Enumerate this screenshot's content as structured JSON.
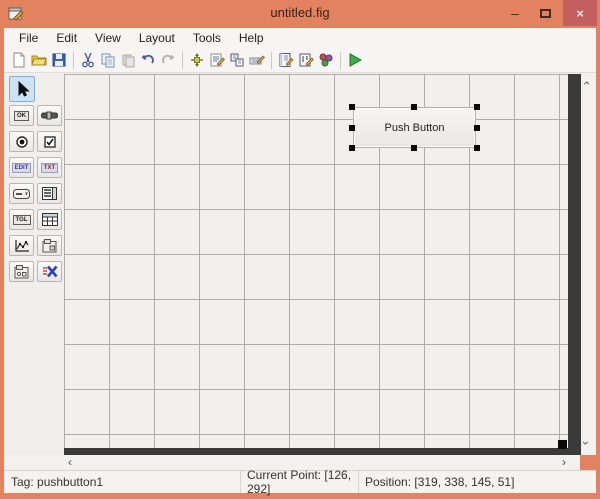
{
  "window": {
    "title": "untitled.fig",
    "controls": {
      "minimize_glyph": "–",
      "close_glyph": "×"
    }
  },
  "menu": {
    "items": [
      {
        "label": "File"
      },
      {
        "label": "Edit"
      },
      {
        "label": "View"
      },
      {
        "label": "Layout"
      },
      {
        "label": "Tools"
      },
      {
        "label": "Help"
      }
    ]
  },
  "toolbar": {
    "icons": [
      {
        "name": "new-figure-icon",
        "enabled": true
      },
      {
        "name": "open-figure-icon",
        "enabled": true
      },
      {
        "name": "save-figure-icon",
        "enabled": true
      },
      {
        "name": "cut-icon",
        "enabled": true
      },
      {
        "name": "copy-icon",
        "enabled": true
      },
      {
        "name": "paste-icon",
        "enabled": false
      },
      {
        "name": "undo-icon",
        "enabled": true
      },
      {
        "name": "redo-icon",
        "enabled": false
      },
      {
        "name": "align-objects-icon",
        "enabled": true
      },
      {
        "name": "menu-editor-icon",
        "enabled": true
      },
      {
        "name": "tab-order-editor-icon",
        "enabled": true
      },
      {
        "name": "toolbar-editor-icon",
        "enabled": true
      },
      {
        "name": "mfile-editor-icon",
        "enabled": true
      },
      {
        "name": "property-inspector-icon",
        "enabled": true
      },
      {
        "name": "object-browser-icon",
        "enabled": true
      },
      {
        "name": "run-icon",
        "enabled": true
      }
    ],
    "run_color": "#3caf4a"
  },
  "palette": {
    "labels": {
      "ok": "OK",
      "edit": "EDIT",
      "txt": "TXT",
      "tgl": "TGL"
    },
    "tools": [
      "select-pointer",
      "push-button-tool",
      "slider-tool",
      "radio-button-tool",
      "check-box-tool",
      "edit-text-tool",
      "static-text-tool",
      "popup-menu-tool",
      "listbox-tool",
      "toggle-button-tool",
      "table-tool",
      "axes-tool",
      "panel-tool",
      "button-group-tool",
      "activex-control-tool"
    ],
    "selected_tool": "select-pointer"
  },
  "canvas": {
    "pushbutton": {
      "label": "Push Button",
      "tag": "pushbutton1",
      "selected": true
    }
  },
  "statusbar": {
    "tag": "Tag: pushbutton1",
    "current_point": "Current Point:  [126, 292]",
    "position": "Position: [319, 338, 145, 51]"
  },
  "colors": {
    "titlebar": "#e2825e",
    "close_button": "#c45f5f",
    "chrome_bg": "#f6f5f3",
    "canvas_bg": "#f1f0ee",
    "grid_line": "#acacaa",
    "outside_figure": "#3a3a3a",
    "selection_handle": "#0a0a0a"
  }
}
